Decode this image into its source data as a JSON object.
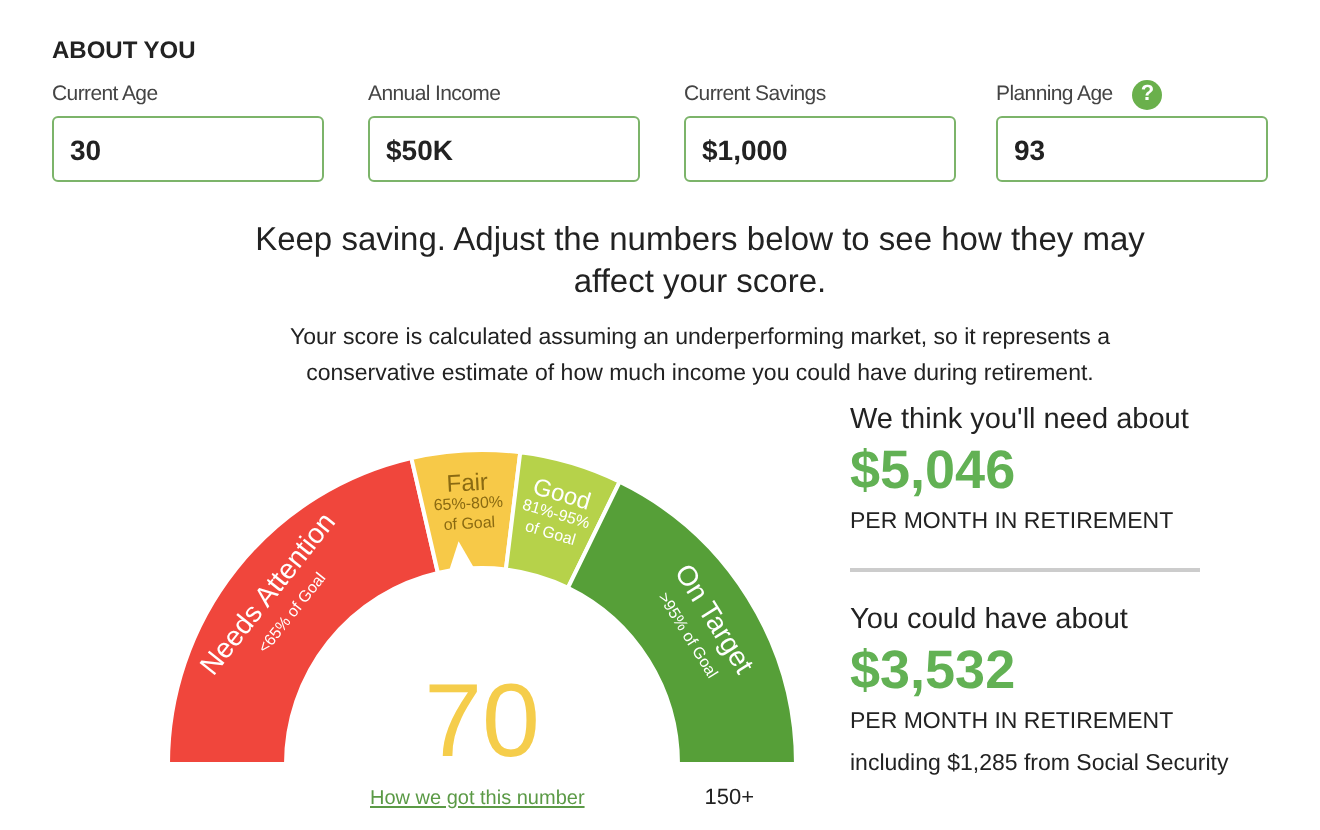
{
  "about_you": {
    "title": "ABOUT YOU",
    "fields": [
      {
        "label": "Current Age",
        "value": "30"
      },
      {
        "label": "Annual Income",
        "value": "$50K"
      },
      {
        "label": "Current Savings",
        "value": "$1,000"
      },
      {
        "label": "Planning Age",
        "value": "93",
        "help": "?"
      }
    ]
  },
  "message": {
    "headline": "Keep saving. Adjust the numbers below to see how they may affect your score.",
    "note": "Your score is calculated assuming an underperforming market, so it represents a conservative estimate of how much income you could have during retirement."
  },
  "gauge": {
    "segments": [
      {
        "title": "Needs Attention",
        "range": [
          "<65% of Goal"
        ],
        "color": "#f0463c"
      },
      {
        "title": "Fair",
        "range": [
          "65%-80%",
          "of Goal"
        ],
        "color": "#f7c948"
      },
      {
        "title": "Good",
        "range": [
          "81%-95%",
          "of Goal"
        ],
        "color": "#b6d24a"
      },
      {
        "title": "On Target",
        "range": [
          ">95% of Goal"
        ],
        "color": "#569f38"
      }
    ],
    "score": "70",
    "link": "How we got this number",
    "max_label": "150+"
  },
  "summary": [
    {
      "lead": "We think you'll need about",
      "amount": "$5,046",
      "unit": "PER MONTH IN RETIREMENT"
    },
    {
      "lead": "You could have about",
      "amount": "$3,532",
      "unit": "PER MONTH IN RETIREMENT",
      "detail": "including $1,285 from Social Security"
    }
  ]
}
